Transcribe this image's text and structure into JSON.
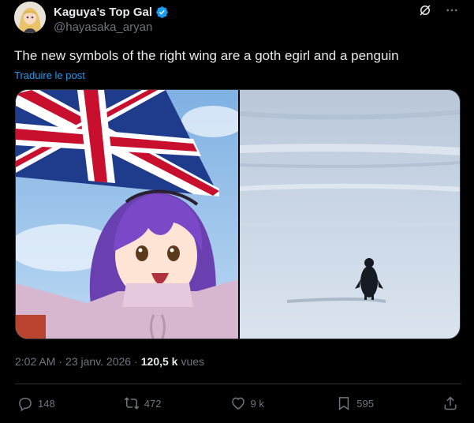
{
  "author": {
    "display_name": "Kaguya’s Top Gal",
    "handle": "@hayasaka_aryan",
    "verified": true
  },
  "header_icons": [
    "grok-icon",
    "more-icon"
  ],
  "tweet": {
    "text": "The new symbols of the right wing are a goth egirl and a penguin",
    "translate_label": "Traduire le post"
  },
  "meta": {
    "time": "2:02 AM",
    "separator": "·",
    "date": "23 janv. 2026",
    "views_count": "120,5 k",
    "views_label": "vues"
  },
  "actions": {
    "replies": "148",
    "reposts": "472",
    "likes": "9 k",
    "bookmarks": "595"
  },
  "colors": {
    "background": "#000000",
    "text": "#e7e9ea",
    "secondary": "#71767b",
    "accent": "#1d9bf0",
    "border": "#2f3336"
  }
}
